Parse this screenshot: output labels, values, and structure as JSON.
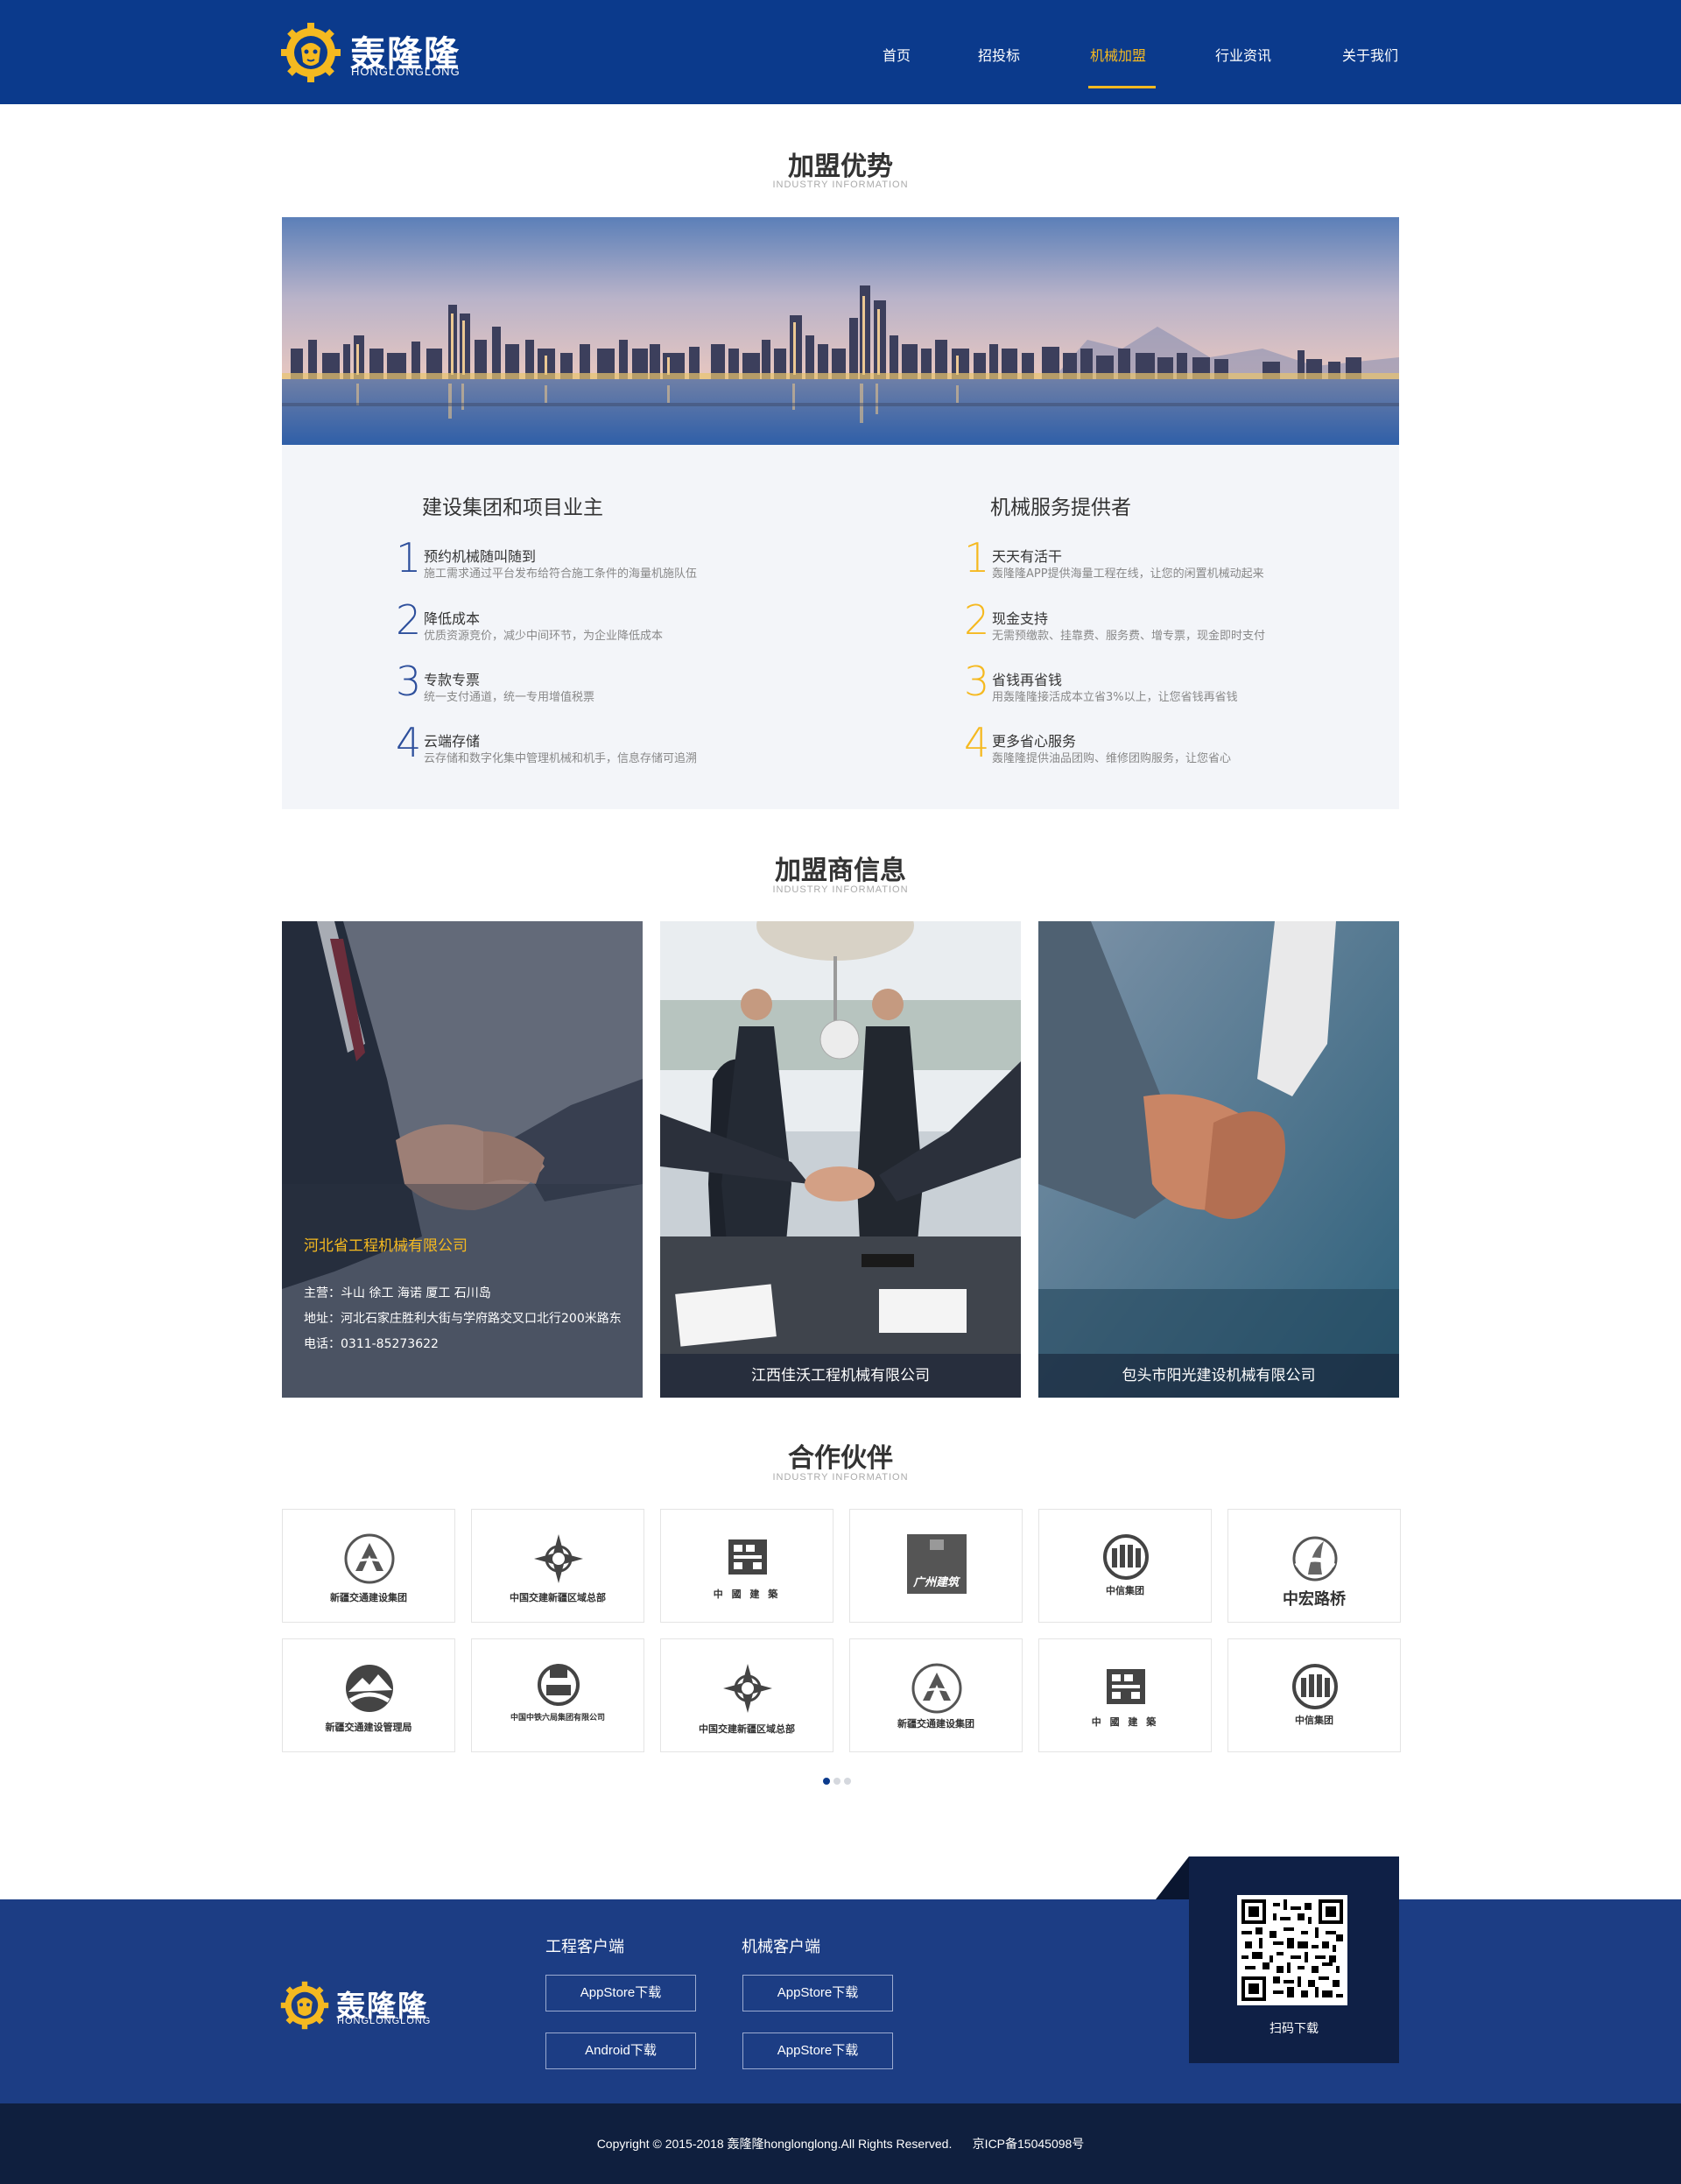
{
  "header": {
    "brand": "轰隆隆",
    "brand_sub": "HONGLONGLONG",
    "nav": [
      {
        "label": "首页"
      },
      {
        "label": "招投标"
      },
      {
        "label": "机械加盟"
      },
      {
        "label": "行业资讯"
      },
      {
        "label": "关于我们"
      }
    ],
    "active_nav": "机械加盟"
  },
  "advantage": {
    "title": "加盟优势",
    "subtitle": "INDUSTRY INFORMATION",
    "left": {
      "heading": "建设集团和项目业主",
      "items": [
        {
          "num": "1",
          "name": "预约机械随叫随到",
          "desc": "施工需求通过平台发布给符合施工条件的海量机施队伍"
        },
        {
          "num": "2",
          "name": "降低成本",
          "desc": "优质资源竞价，减少中间环节，为企业降低成本"
        },
        {
          "num": "3",
          "name": "专款专票",
          "desc": "统一支付通道，统一专用增值税票"
        },
        {
          "num": "4",
          "name": "云端存储",
          "desc": "云存储和数字化集中管理机械和机手，信息存储可追溯"
        }
      ]
    },
    "right": {
      "heading": "机械服务提供者",
      "items": [
        {
          "num": "1",
          "name": "天天有活干",
          "desc": "轰隆隆APP提供海量工程在线，让您的闲置机械动起来"
        },
        {
          "num": "2",
          "name": "现金支持",
          "desc": "无需预缴款、挂靠费、服务费、增专票，现金即时支付"
        },
        {
          "num": "3",
          "name": "省钱再省钱",
          "desc": "用轰隆隆接活成本立省3%以上，让您省钱再省钱"
        },
        {
          "num": "4",
          "name": "更多省心服务",
          "desc": "轰隆隆提供油品团购、维修团购服务，让您省心"
        }
      ]
    },
    "colors": {
      "left_num": "#2d4f9c",
      "right_num": "#f5b920"
    }
  },
  "franchisee": {
    "title": "加盟商信息",
    "subtitle": "INDUSTRY INFORMATION",
    "cards": [
      {
        "name": "河北省工程机械有限公司",
        "lines": [
          "主营：斗山 徐工 海诺 厦工 石川岛",
          "地址：河北石家庄胜利大街与学府路交叉口北行200米路东",
          "电话：0311-85273622"
        ]
      },
      {
        "name": "江西佳沃工程机械有限公司"
      },
      {
        "name": "包头市阳光建设机械有限公司"
      }
    ]
  },
  "partners": {
    "title": "合作伙伴",
    "subtitle": "INDUSTRY INFORMATION",
    "row1": [
      {
        "name": "新疆交通建设集团",
        "icon": "xinjiang-jiaotong-icon"
      },
      {
        "name": "中国交建新疆区域总部",
        "icon": "ccc-icon"
      },
      {
        "name": "中 國 建 築",
        "icon": "cscec-icon"
      },
      {
        "name": "广州建筑",
        "icon": "guangzhou-jianzhu-icon"
      },
      {
        "name": "中信集团",
        "icon": "citic-icon"
      },
      {
        "name": "中宏路桥",
        "icon": "zhonghong-icon"
      }
    ],
    "row2": [
      {
        "name": "新疆交通建设管理局",
        "icon": "xinjiang-guanli-icon"
      },
      {
        "name": "中国中铁六局集团有限公司",
        "icon": "crec-icon"
      },
      {
        "name": "中国交建新疆区域总部",
        "icon": "ccc-icon"
      },
      {
        "name": "新疆交通建设集团",
        "icon": "xinjiang-jiaotong-icon"
      },
      {
        "name": "中 國 建 築",
        "icon": "cscec-icon"
      },
      {
        "name": "中信集团",
        "icon": "citic-icon"
      }
    ],
    "pagination_active": 1
  },
  "footer": {
    "brand": "轰隆隆",
    "brand_sub": "HONGLONGLONG",
    "col1_title": "工程客户端",
    "col1_buttons": [
      "AppStore下载",
      "Android下载"
    ],
    "col2_title": "机械客户端",
    "col2_buttons": [
      "AppStore下载",
      "AppStore下载"
    ],
    "qr_label": "扫码下载",
    "copyright": "Copyright © 2015-2018 轰隆隆honglonglong.All Rights Reserved.      京ICP备15045098号"
  }
}
